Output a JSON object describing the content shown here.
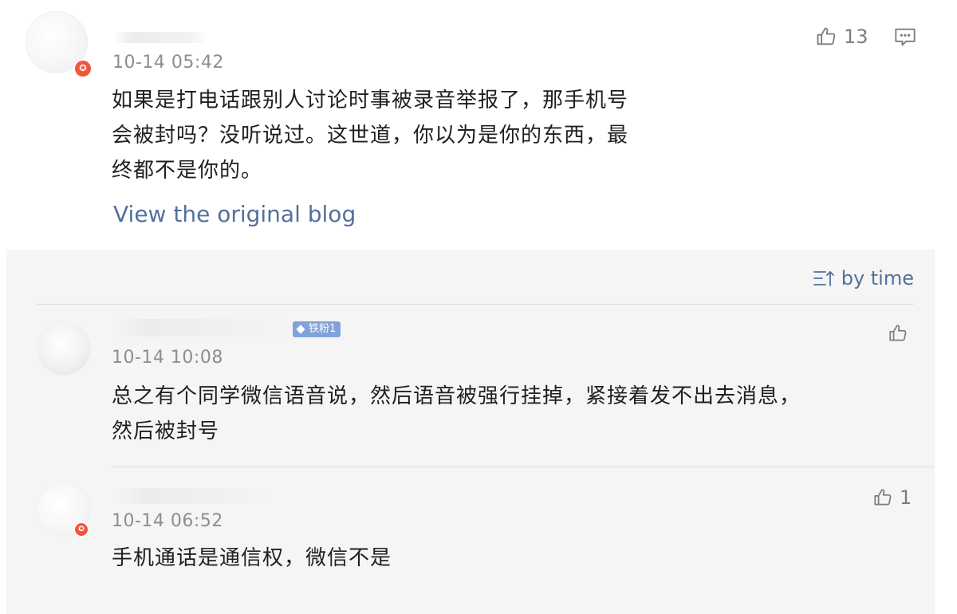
{
  "post_comment": {
    "time": "10-14 05:42",
    "like_count": "13",
    "text_lines": [
      "如果是打电话跟别人讨论时事被录音举报了，那手机号",
      "会被封吗？没听说过。这世道，你以为是你的东西，最",
      "终都不是你的。"
    ],
    "view_original_label": "View the original blog"
  },
  "replies": {
    "sort_label": "by time",
    "items": [
      {
        "time": "10-14 10:08",
        "badge": "铁粉1",
        "like_count": "",
        "text_lines": [
          "总之有个同学微信语音说，然后语音被强行挂掉，紧接着发不出去消息，",
          "然后被封号"
        ]
      },
      {
        "time": "10-14 06:52",
        "like_count": "1",
        "text_lines": [
          "手机通话是通信权，微信不是"
        ]
      }
    ]
  },
  "colors": {
    "link": "#52709c",
    "panel_bg": "#f5f5f5",
    "badge_bg": "#7fa3d9",
    "avatar_badge": "#f0563f"
  },
  "icons": [
    "thumb-up-icon",
    "comment-icon",
    "sort-icon",
    "diamond-icon"
  ]
}
